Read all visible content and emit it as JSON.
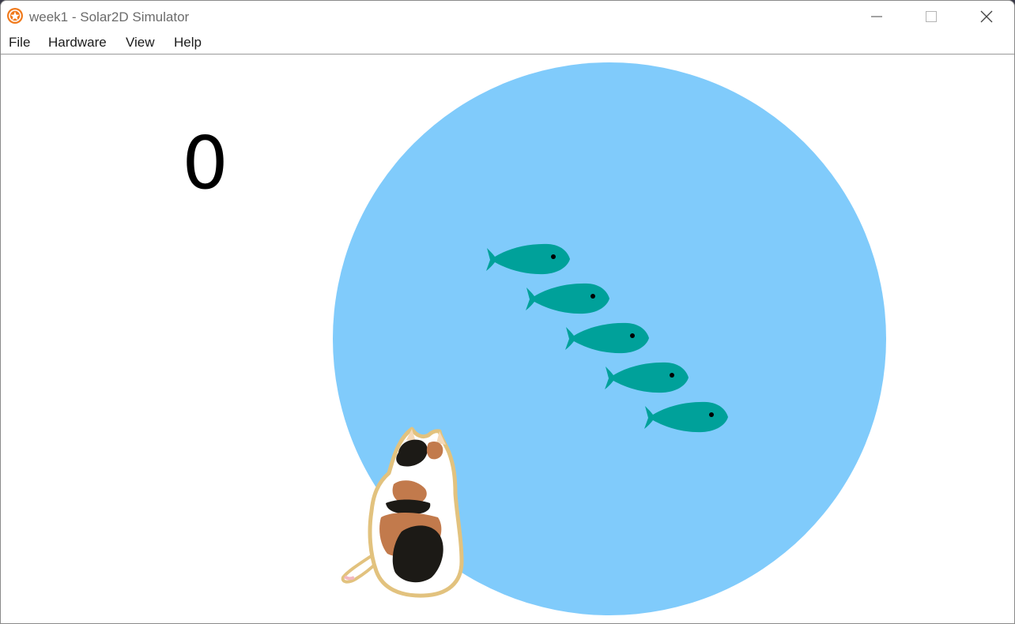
{
  "window": {
    "title": "week1  -  Solar2D Simulator",
    "controls": {
      "minimize": "minimize-icon",
      "maximize": "maximize-icon",
      "close": "close-icon"
    }
  },
  "menu": {
    "items": [
      "File",
      "Hardware",
      "View",
      "Help"
    ]
  },
  "game": {
    "score": "0",
    "pond_color": "#80cbfb",
    "fish_color": "#00a19a",
    "fish_count": 5,
    "cat": "calico-cat"
  }
}
